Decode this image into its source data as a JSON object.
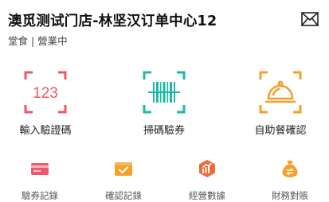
{
  "header": {
    "store_name": "澳觅测试门店-林坚汉订单中心12",
    "store_status": "堂食 | 營業中",
    "mail_icon": "mail-icon"
  },
  "main_actions": [
    {
      "label": "輸入驗證碼",
      "icon": "code-entry-icon",
      "icon_text": "123",
      "color": "#f0576a"
    },
    {
      "label": "掃碼驗券",
      "icon": "barcode-scan-icon",
      "color": "#1fb8a6"
    },
    {
      "label": "自助餐確認",
      "icon": "buffet-cloche-icon",
      "color": "#f5a02a"
    }
  ],
  "secondary_actions": [
    {
      "label": "驗券記錄",
      "icon": "voucher-record-icon",
      "color": "#f0576a"
    },
    {
      "label": "確認記錄",
      "icon": "confirm-record-icon",
      "color": "#f5a02a"
    },
    {
      "label": "經營數據",
      "icon": "business-data-icon",
      "color": "#f06a3a"
    },
    {
      "label": "財務對賬",
      "icon": "finance-reconcile-icon",
      "color": "#f5a02a"
    }
  ]
}
